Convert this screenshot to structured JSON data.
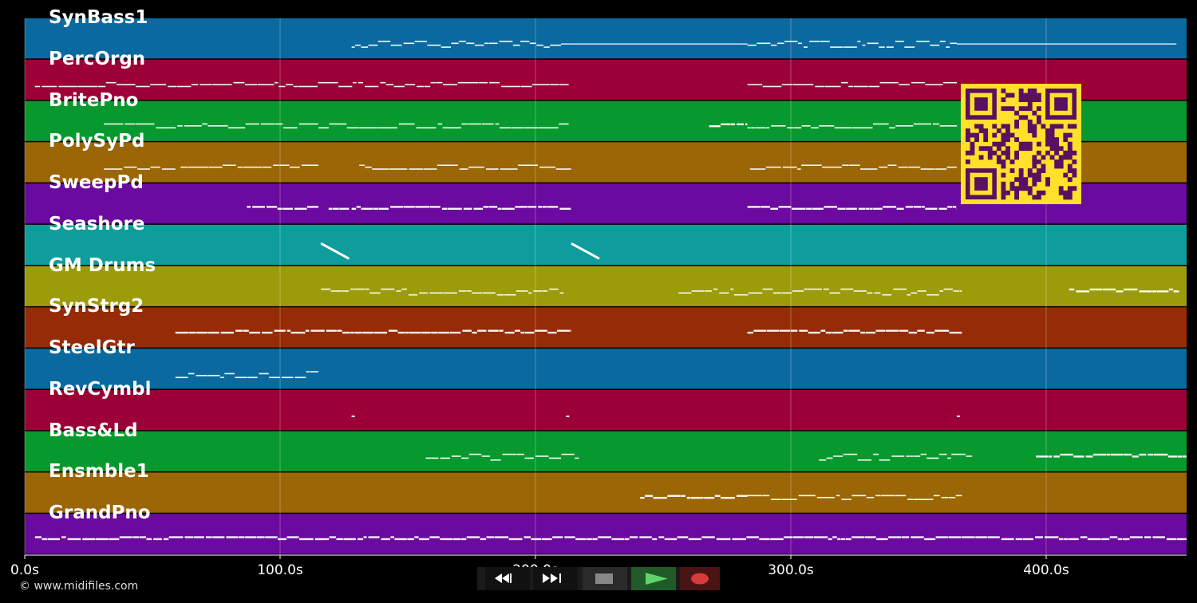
{
  "colors": {
    "background": "#000000",
    "lane_colors": [
      "#0a6aa0",
      "#9c0036",
      "#07992e",
      "#9a6606",
      "#6a0a9e",
      "#0e9c9c",
      "#9c9c0a",
      "#962b07"
    ],
    "note": "#ffffff",
    "qr_fg": "#5a1060",
    "qr_bg": "#ffe02a"
  },
  "tracks": [
    {
      "name": "SynBass1"
    },
    {
      "name": "PercOrgn"
    },
    {
      "name": "BritePno"
    },
    {
      "name": "PolySyPd"
    },
    {
      "name": "SweepPd"
    },
    {
      "name": "Seashore"
    },
    {
      "name": "GM Drums"
    },
    {
      "name": "SynStrg2"
    },
    {
      "name": "SteelGtr"
    },
    {
      "name": "RevCymbl"
    },
    {
      "name": "Bass&Ld"
    },
    {
      "name": "Ensmble1"
    },
    {
      "name": "GrandPno"
    }
  ],
  "timeline": {
    "ticks": [
      "0.0s",
      "100.0s",
      "200.0s",
      "300.0s",
      "400.0s"
    ],
    "tick_values": [
      0,
      100,
      200,
      300,
      400
    ],
    "xlim": [
      0,
      455
    ]
  },
  "note_segments": [
    {
      "track": 0,
      "start": 128,
      "end": 210,
      "style": "dense"
    },
    {
      "track": 0,
      "start": 210,
      "end": 283,
      "style": "line"
    },
    {
      "track": 0,
      "start": 283,
      "end": 365,
      "style": "dense"
    },
    {
      "track": 0,
      "start": 365,
      "end": 451,
      "style": "line"
    },
    {
      "track": 1,
      "start": 4,
      "end": 213,
      "style": "wave"
    },
    {
      "track": 1,
      "start": 283,
      "end": 365,
      "style": "wave"
    },
    {
      "track": 2,
      "start": 31,
      "end": 213,
      "style": "wave"
    },
    {
      "track": 2,
      "start": 268,
      "end": 283,
      "style": "thick"
    },
    {
      "track": 2,
      "start": 283,
      "end": 365,
      "style": "wave"
    },
    {
      "track": 3,
      "start": 31,
      "end": 59,
      "style": "wave"
    },
    {
      "track": 3,
      "start": 61,
      "end": 115,
      "style": "wave"
    },
    {
      "track": 3,
      "start": 131,
      "end": 214,
      "style": "wave"
    },
    {
      "track": 3,
      "start": 284,
      "end": 365,
      "style": "wave"
    },
    {
      "track": 4,
      "start": 87,
      "end": 115,
      "style": "thick"
    },
    {
      "track": 4,
      "start": 119,
      "end": 127,
      "style": "thick"
    },
    {
      "track": 4,
      "start": 128,
      "end": 214,
      "style": "thick"
    },
    {
      "track": 4,
      "start": 283,
      "end": 365,
      "style": "thick"
    },
    {
      "track": 5,
      "start": 116,
      "end": 127,
      "style": "slash"
    },
    {
      "track": 5,
      "start": 214,
      "end": 225,
      "style": "slash"
    },
    {
      "track": 6,
      "start": 116,
      "end": 211,
      "style": "dense"
    },
    {
      "track": 6,
      "start": 256,
      "end": 367,
      "style": "dense"
    },
    {
      "track": 6,
      "start": 409,
      "end": 452,
      "style": "thick"
    },
    {
      "track": 7,
      "start": 59,
      "end": 214,
      "style": "thick"
    },
    {
      "track": 7,
      "start": 283,
      "end": 367,
      "style": "thick"
    },
    {
      "track": 8,
      "start": 59,
      "end": 115,
      "style": "dense"
    },
    {
      "track": 9,
      "start": 128,
      "end": 129,
      "style": "dot"
    },
    {
      "track": 9,
      "start": 212,
      "end": 213,
      "style": "dot"
    },
    {
      "track": 9,
      "start": 365,
      "end": 366,
      "style": "dot"
    },
    {
      "track": 10,
      "start": 157,
      "end": 217,
      "style": "dense"
    },
    {
      "track": 10,
      "start": 311,
      "end": 371,
      "style": "dense"
    },
    {
      "track": 10,
      "start": 396,
      "end": 455,
      "style": "thick"
    },
    {
      "track": 11,
      "start": 241,
      "end": 283,
      "style": "thick"
    },
    {
      "track": 11,
      "start": 283,
      "end": 367,
      "style": "wave"
    },
    {
      "track": 12,
      "start": 4,
      "end": 455,
      "style": "thick"
    }
  ],
  "copyright": "© www.midifiles.com",
  "transport": {
    "rewind_icon": "rewind-icon",
    "fast_forward_icon": "fast-forward-icon",
    "stop_icon": "stop-icon",
    "play_icon": "play-icon",
    "record_icon": "record-icon"
  }
}
